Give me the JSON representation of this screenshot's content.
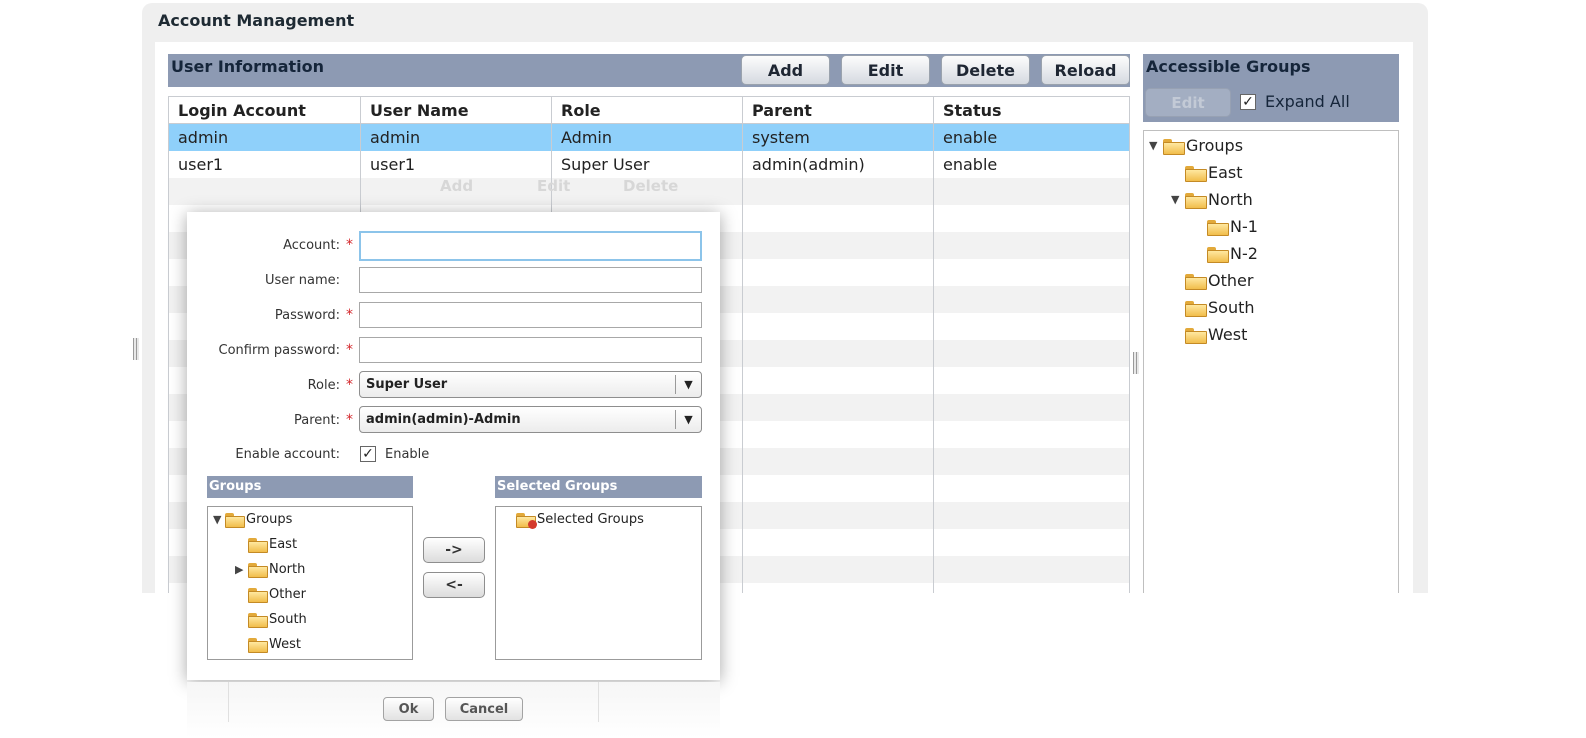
{
  "page": {
    "title": "Account Management"
  },
  "user_info": {
    "title": "User Information",
    "buttons": {
      "add": "Add",
      "edit": "Edit",
      "delete": "Delete",
      "reload": "Reload"
    },
    "columns": [
      "Login Account",
      "User Name",
      "Role",
      "Parent",
      "Status"
    ],
    "rows": [
      {
        "login": "admin",
        "name": "admin",
        "role": "Admin",
        "parent": "system",
        "status": "enable",
        "selected": true
      },
      {
        "login": "user1",
        "name": "user1",
        "role": "Super User",
        "parent": "admin(admin)",
        "status": "enable",
        "selected": false
      }
    ],
    "ghost_buttons": [
      "Add",
      "Edit",
      "Delete"
    ]
  },
  "accessible_groups": {
    "title": "Accessible Groups",
    "edit_label": "Edit",
    "expand_all_label": "Expand All",
    "expand_all_checked": true,
    "tree": {
      "root": "Groups",
      "east": "East",
      "north": "North",
      "n1": "N-1",
      "n2": "N-2",
      "other": "Other",
      "south": "South",
      "west": "West"
    }
  },
  "dialog": {
    "labels": {
      "account": "Account:",
      "user_name": "User name:",
      "password": "Password:",
      "confirm_password": "Confirm password:",
      "role": "Role:",
      "parent": "Parent:",
      "enable_account": "Enable account:"
    },
    "required_mark": "*",
    "values": {
      "account": "",
      "user_name": "",
      "password": "",
      "confirm_password": "",
      "role": "Super User",
      "parent": "admin(admin)-Admin"
    },
    "enable_label": "Enable",
    "enable_checked": true,
    "groups_header": "Groups",
    "selected_groups_header": "Selected Groups",
    "groups_tree": {
      "root": "Groups",
      "east": "East",
      "north": "North",
      "other": "Other",
      "south": "South",
      "west": "West"
    },
    "selected_groups_root": "Selected Groups",
    "move_right": "->",
    "move_left": "<-",
    "ok": "Ok",
    "cancel": "Cancel"
  },
  "colors": {
    "header_bg": "#8d9ab3",
    "selected_row": "#8fd0fa",
    "stripe": "#f2f2f2",
    "required": "#d3262b"
  }
}
